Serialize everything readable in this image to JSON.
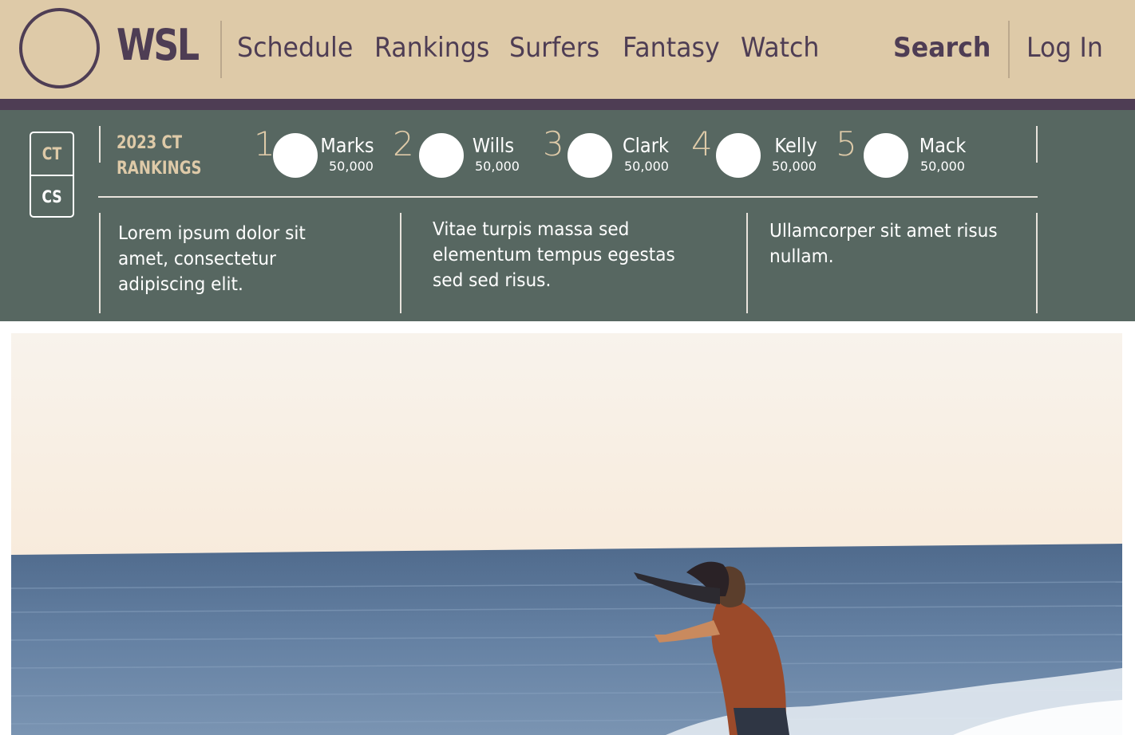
{
  "header": {
    "brand": "WSL",
    "nav": [
      "Schedule",
      "Rankings",
      "Surfers",
      "Fantasy",
      "Watch"
    ],
    "search_label": "Search",
    "login_label": "Log In"
  },
  "rankings": {
    "tours": [
      "CT",
      "CS"
    ],
    "active_tour": "CT",
    "title_line1": "2023 CT",
    "title_line2": "RANKINGS",
    "surfers": [
      {
        "rank": "1",
        "name": "Marks",
        "points": "50,000"
      },
      {
        "rank": "2",
        "name": "Wills",
        "points": "50,000"
      },
      {
        "rank": "3",
        "name": "Clark",
        "points": "50,000"
      },
      {
        "rank": "4",
        "name": "Kelly",
        "points": "50,000"
      },
      {
        "rank": "5",
        "name": "Mack",
        "points": "50,000"
      }
    ]
  },
  "blurbs": [
    "Lorem ipsum dolor sit amet, consectetur adipiscing elit.",
    "Vitae turpis massa sed elementum tempus egestas sed sed risus.",
    "Ullamcorper sit amet risus nullam."
  ],
  "colors": {
    "header_bg": "#decaa8",
    "brand_purple": "#4e3d54",
    "panel_green": "#576761",
    "accent_sand": "#decaa8"
  },
  "icons": {
    "logo": "circle-logo-icon",
    "avatar": "avatar-placeholder-icon"
  }
}
